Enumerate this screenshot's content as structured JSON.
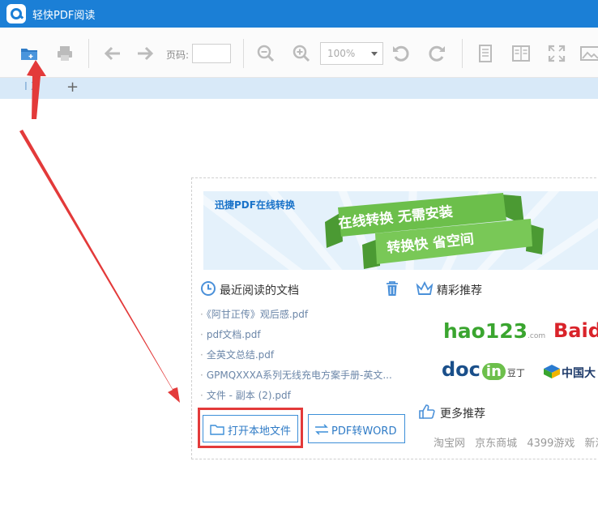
{
  "app": {
    "title": "轻快PDF阅读"
  },
  "toolbar": {
    "page_label": "页码:",
    "page_value": "",
    "zoom_value": "100%"
  },
  "tabs": {
    "tab_label": "I X",
    "add_label": "+"
  },
  "banner": {
    "brand": "迅捷PDF在线转换",
    "line1": "在线转换 无需安装",
    "line2": "转换快 省空间"
  },
  "recent": {
    "title": "最近阅读的文档",
    "items": [
      "《阿甘正传》观后感.pdf",
      "pdf文档.pdf",
      "全英文总结.pdf",
      "GPMQXXXA系列无线充电方案手册-英文...",
      "文件 - 副本 (2).pdf"
    ]
  },
  "recommend": {
    "title": "精彩推荐",
    "more_title": "更多推荐",
    "logos": {
      "hao123": "hao123",
      "hao123_suffix": ".com",
      "baidu": "Baidu",
      "docin": "doc",
      "docin_in": "in",
      "docin_cn": "豆丁",
      "china": "中国大"
    },
    "links": [
      "淘宝网",
      "京东商城",
      "4399游戏",
      "新浪"
    ]
  },
  "buttons": {
    "open_local": "打开本地文件",
    "pdf_to_word": "PDF转WORD"
  },
  "colors": {
    "titlebar": "#1b7fd6",
    "accent": "#2f7bc6",
    "highlight": "#e33a3a",
    "banner_green": "#6cbf4b"
  }
}
